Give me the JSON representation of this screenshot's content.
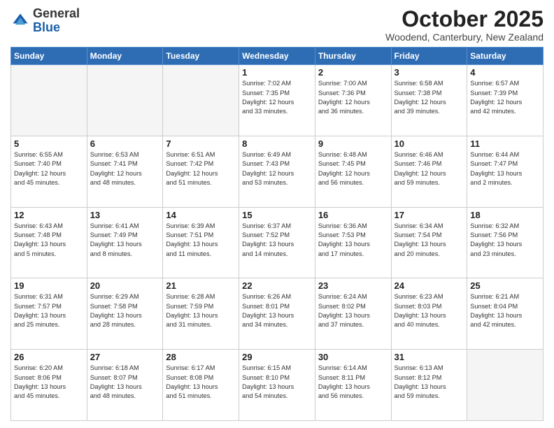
{
  "header": {
    "logo_general": "General",
    "logo_blue": "Blue",
    "month_title": "October 2025",
    "subtitle": "Woodend, Canterbury, New Zealand"
  },
  "weekdays": [
    "Sunday",
    "Monday",
    "Tuesday",
    "Wednesday",
    "Thursday",
    "Friday",
    "Saturday"
  ],
  "weeks": [
    [
      {
        "day": "",
        "info": ""
      },
      {
        "day": "",
        "info": ""
      },
      {
        "day": "",
        "info": ""
      },
      {
        "day": "1",
        "info": "Sunrise: 7:02 AM\nSunset: 7:35 PM\nDaylight: 12 hours\nand 33 minutes."
      },
      {
        "day": "2",
        "info": "Sunrise: 7:00 AM\nSunset: 7:36 PM\nDaylight: 12 hours\nand 36 minutes."
      },
      {
        "day": "3",
        "info": "Sunrise: 6:58 AM\nSunset: 7:38 PM\nDaylight: 12 hours\nand 39 minutes."
      },
      {
        "day": "4",
        "info": "Sunrise: 6:57 AM\nSunset: 7:39 PM\nDaylight: 12 hours\nand 42 minutes."
      }
    ],
    [
      {
        "day": "5",
        "info": "Sunrise: 6:55 AM\nSunset: 7:40 PM\nDaylight: 12 hours\nand 45 minutes."
      },
      {
        "day": "6",
        "info": "Sunrise: 6:53 AM\nSunset: 7:41 PM\nDaylight: 12 hours\nand 48 minutes."
      },
      {
        "day": "7",
        "info": "Sunrise: 6:51 AM\nSunset: 7:42 PM\nDaylight: 12 hours\nand 51 minutes."
      },
      {
        "day": "8",
        "info": "Sunrise: 6:49 AM\nSunset: 7:43 PM\nDaylight: 12 hours\nand 53 minutes."
      },
      {
        "day": "9",
        "info": "Sunrise: 6:48 AM\nSunset: 7:45 PM\nDaylight: 12 hours\nand 56 minutes."
      },
      {
        "day": "10",
        "info": "Sunrise: 6:46 AM\nSunset: 7:46 PM\nDaylight: 12 hours\nand 59 minutes."
      },
      {
        "day": "11",
        "info": "Sunrise: 6:44 AM\nSunset: 7:47 PM\nDaylight: 13 hours\nand 2 minutes."
      }
    ],
    [
      {
        "day": "12",
        "info": "Sunrise: 6:43 AM\nSunset: 7:48 PM\nDaylight: 13 hours\nand 5 minutes."
      },
      {
        "day": "13",
        "info": "Sunrise: 6:41 AM\nSunset: 7:49 PM\nDaylight: 13 hours\nand 8 minutes."
      },
      {
        "day": "14",
        "info": "Sunrise: 6:39 AM\nSunset: 7:51 PM\nDaylight: 13 hours\nand 11 minutes."
      },
      {
        "day": "15",
        "info": "Sunrise: 6:37 AM\nSunset: 7:52 PM\nDaylight: 13 hours\nand 14 minutes."
      },
      {
        "day": "16",
        "info": "Sunrise: 6:36 AM\nSunset: 7:53 PM\nDaylight: 13 hours\nand 17 minutes."
      },
      {
        "day": "17",
        "info": "Sunrise: 6:34 AM\nSunset: 7:54 PM\nDaylight: 13 hours\nand 20 minutes."
      },
      {
        "day": "18",
        "info": "Sunrise: 6:32 AM\nSunset: 7:56 PM\nDaylight: 13 hours\nand 23 minutes."
      }
    ],
    [
      {
        "day": "19",
        "info": "Sunrise: 6:31 AM\nSunset: 7:57 PM\nDaylight: 13 hours\nand 25 minutes."
      },
      {
        "day": "20",
        "info": "Sunrise: 6:29 AM\nSunset: 7:58 PM\nDaylight: 13 hours\nand 28 minutes."
      },
      {
        "day": "21",
        "info": "Sunrise: 6:28 AM\nSunset: 7:59 PM\nDaylight: 13 hours\nand 31 minutes."
      },
      {
        "day": "22",
        "info": "Sunrise: 6:26 AM\nSunset: 8:01 PM\nDaylight: 13 hours\nand 34 minutes."
      },
      {
        "day": "23",
        "info": "Sunrise: 6:24 AM\nSunset: 8:02 PM\nDaylight: 13 hours\nand 37 minutes."
      },
      {
        "day": "24",
        "info": "Sunrise: 6:23 AM\nSunset: 8:03 PM\nDaylight: 13 hours\nand 40 minutes."
      },
      {
        "day": "25",
        "info": "Sunrise: 6:21 AM\nSunset: 8:04 PM\nDaylight: 13 hours\nand 42 minutes."
      }
    ],
    [
      {
        "day": "26",
        "info": "Sunrise: 6:20 AM\nSunset: 8:06 PM\nDaylight: 13 hours\nand 45 minutes."
      },
      {
        "day": "27",
        "info": "Sunrise: 6:18 AM\nSunset: 8:07 PM\nDaylight: 13 hours\nand 48 minutes."
      },
      {
        "day": "28",
        "info": "Sunrise: 6:17 AM\nSunset: 8:08 PM\nDaylight: 13 hours\nand 51 minutes."
      },
      {
        "day": "29",
        "info": "Sunrise: 6:15 AM\nSunset: 8:10 PM\nDaylight: 13 hours\nand 54 minutes."
      },
      {
        "day": "30",
        "info": "Sunrise: 6:14 AM\nSunset: 8:11 PM\nDaylight: 13 hours\nand 56 minutes."
      },
      {
        "day": "31",
        "info": "Sunrise: 6:13 AM\nSunset: 8:12 PM\nDaylight: 13 hours\nand 59 minutes."
      },
      {
        "day": "",
        "info": ""
      }
    ]
  ]
}
